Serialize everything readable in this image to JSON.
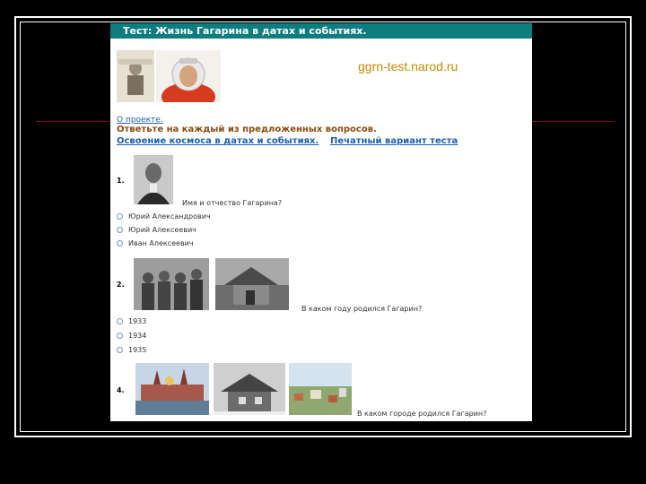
{
  "page": {
    "title": "Тест: Жизнь Гагарина в датах и событиях.",
    "site": "ggrn-test.narod.ru",
    "about_link": "О проекте.",
    "instruction": "Ответьте на каждый из предложенных вопросов.",
    "nav_link_1": "Освоение космоса в датах и событиях.",
    "nav_link_2": "Печатный вариант теста"
  },
  "questions": [
    {
      "number": "1.",
      "text": "Имя и отчество Гагарина?",
      "options": [
        "Юрий Александрович",
        "Юрий Алексеевич",
        "Иван Алексеевич"
      ]
    },
    {
      "number": "2.",
      "text": "В каком году родился Гагарин?",
      "options": [
        "1933",
        "1934",
        "1935"
      ]
    },
    {
      "number": "4.",
      "text": "В каком городе родился Гагарин?",
      "options": []
    }
  ],
  "colors": {
    "title_bar": "#0e7d80",
    "link": "#1b5fb5",
    "instruction": "#8b4a12",
    "site_text": "#c58a00"
  }
}
